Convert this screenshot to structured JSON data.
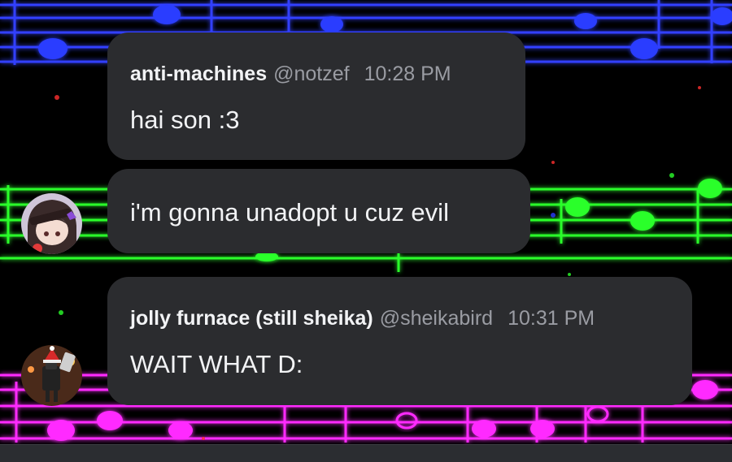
{
  "messages": [
    {
      "author": "anti-machines",
      "handle": "@notzef",
      "time": "10:28 PM",
      "lines": [
        "hai son :3",
        "i'm gonna unadopt u cuz evil"
      ]
    },
    {
      "author": "jolly furnace (still sheika)",
      "handle": "@sheikabird",
      "time": "10:31 PM",
      "lines": [
        "WAIT WHAT D:"
      ]
    }
  ],
  "avatars": [
    {
      "icon": "purple-hair-character-avatar"
    },
    {
      "icon": "robot-santa-hat-avatar"
    }
  ],
  "colors": {
    "bubble": "#2b2c2f",
    "author_text": "#f2f3f5",
    "muted_text": "#9a9ca3",
    "staff_blue": "#2a3cff",
    "staff_green": "#2bff2b",
    "staff_magenta": "#ff2bff"
  }
}
